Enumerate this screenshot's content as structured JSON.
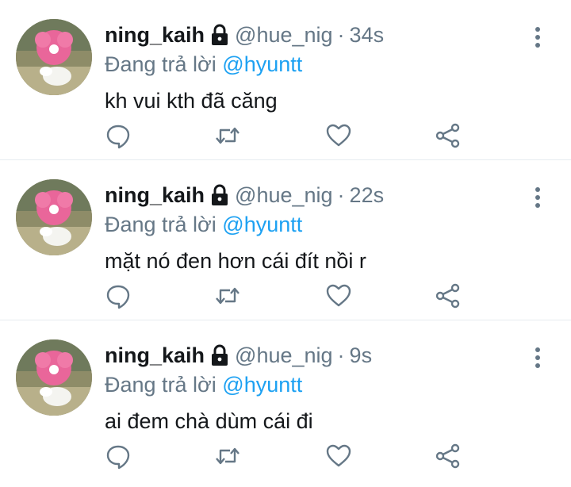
{
  "tweets": [
    {
      "name": "ning_kaih",
      "handle": "@hue_nig",
      "time": "34s",
      "replying_prefix": "Đang trả lời",
      "replying_to": "@hyuntt",
      "text": "kh vui kth đã căng"
    },
    {
      "name": "ning_kaih",
      "handle": "@hue_nig",
      "time": "22s",
      "replying_prefix": "Đang trả lời",
      "replying_to": "@hyuntt",
      "text": "mặt nó đen hơn cái đít nồi r"
    },
    {
      "name": "ning_kaih",
      "handle": "@hue_nig",
      "time": "9s",
      "replying_prefix": "Đang trả lời",
      "replying_to": "@hyuntt",
      "text": "ai đem chà dùm cái đi"
    }
  ],
  "separator": "·",
  "icons": {
    "lock": "lock-icon",
    "more": "more-vertical-icon",
    "reply": "reply-icon",
    "retweet": "retweet-icon",
    "like": "heart-icon",
    "share": "share-icon"
  },
  "colors": {
    "text": "#14171a",
    "secondary": "#657786",
    "accent": "#1da1f2",
    "divider": "#e6ecf0"
  }
}
